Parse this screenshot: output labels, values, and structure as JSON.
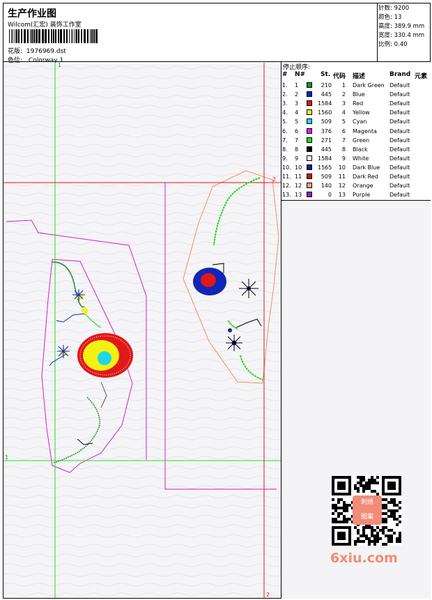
{
  "header": {
    "title": "生产作业图",
    "studio": "Wilcom(汇宏) 装饰工作室",
    "design_label": "花版:",
    "design_file": "1976969.dst",
    "color_label": "色位:",
    "colorway": "Colorway 1"
  },
  "stats": [
    {
      "label": "针数:",
      "value": "9200"
    },
    {
      "label": "颜色:",
      "value": "13"
    },
    {
      "label": "高度:",
      "value": "389.9 mm"
    },
    {
      "label": "宽度:",
      "value": "330.4 mm"
    },
    {
      "label": "比例:",
      "value": "0.40"
    }
  ],
  "legend": {
    "title": "停止顺序:",
    "headers": {
      "num": "#",
      "n": "N#",
      "st": "St.",
      "code": "代码",
      "desc": "描述",
      "brand": "Brand",
      "element": "元素"
    },
    "rows": [
      {
        "num": "1.",
        "n": "1",
        "color": "#1e8f2c",
        "st": "210",
        "code": "1",
        "desc": "Dark Green",
        "brand": "Default"
      },
      {
        "num": "2.",
        "n": "2",
        "color": "#1026b8",
        "st": "445",
        "code": "2",
        "desc": "Blue",
        "brand": "Default"
      },
      {
        "num": "3.",
        "n": "3",
        "color": "#e01818",
        "st": "1584",
        "code": "3",
        "desc": "Red",
        "brand": "Default"
      },
      {
        "num": "4.",
        "n": "4",
        "color": "#f4f014",
        "st": "1560",
        "code": "4",
        "desc": "Yellow",
        "brand": "Default"
      },
      {
        "num": "5.",
        "n": "5",
        "color": "#1ed8e8",
        "st": "509",
        "code": "5",
        "desc": "Cyan",
        "brand": "Default"
      },
      {
        "num": "6.",
        "n": "6",
        "color": "#e020d8",
        "st": "376",
        "code": "6",
        "desc": "Magenta",
        "brand": "Default"
      },
      {
        "num": "7.",
        "n": "7",
        "color": "#20d820",
        "st": "271",
        "code": "7",
        "desc": "Green",
        "brand": "Default"
      },
      {
        "num": "8.",
        "n": "8",
        "color": "#000000",
        "st": "445",
        "code": "8",
        "desc": "Black",
        "brand": "Default"
      },
      {
        "num": "9.",
        "n": "9",
        "color": "#f2f2f2",
        "st": "1584",
        "code": "9",
        "desc": "White",
        "brand": "Default"
      },
      {
        "num": "10.",
        "n": "10",
        "color": "#1020a0",
        "st": "1565",
        "code": "10",
        "desc": "Dark Blue",
        "brand": "Default"
      },
      {
        "num": "11.",
        "n": "11",
        "color": "#d01010",
        "st": "509",
        "code": "11",
        "desc": "Dark Red",
        "brand": "Default"
      },
      {
        "num": "12.",
        "n": "12",
        "color": "#f4a070",
        "st": "140",
        "code": "12",
        "desc": "Orange",
        "brand": "Default"
      },
      {
        "num": "13.",
        "n": "13",
        "color": "#9020c0",
        "st": "0",
        "code": "13",
        "desc": "Purple",
        "brand": "Default"
      }
    ]
  },
  "guides": {
    "v1": "1",
    "h1": "1",
    "v2": "2",
    "h2": "2"
  },
  "watermark": {
    "text": "6xiu.com",
    "qr_caption_top": "刺绣",
    "qr_caption_bottom": "图案"
  },
  "colors": {
    "guide_green": "#22dd22",
    "guide_red": "#e01818",
    "outline_magenta": "#d020d0",
    "outline_orange": "#f09060",
    "accent_watermark": "#f08c78"
  }
}
